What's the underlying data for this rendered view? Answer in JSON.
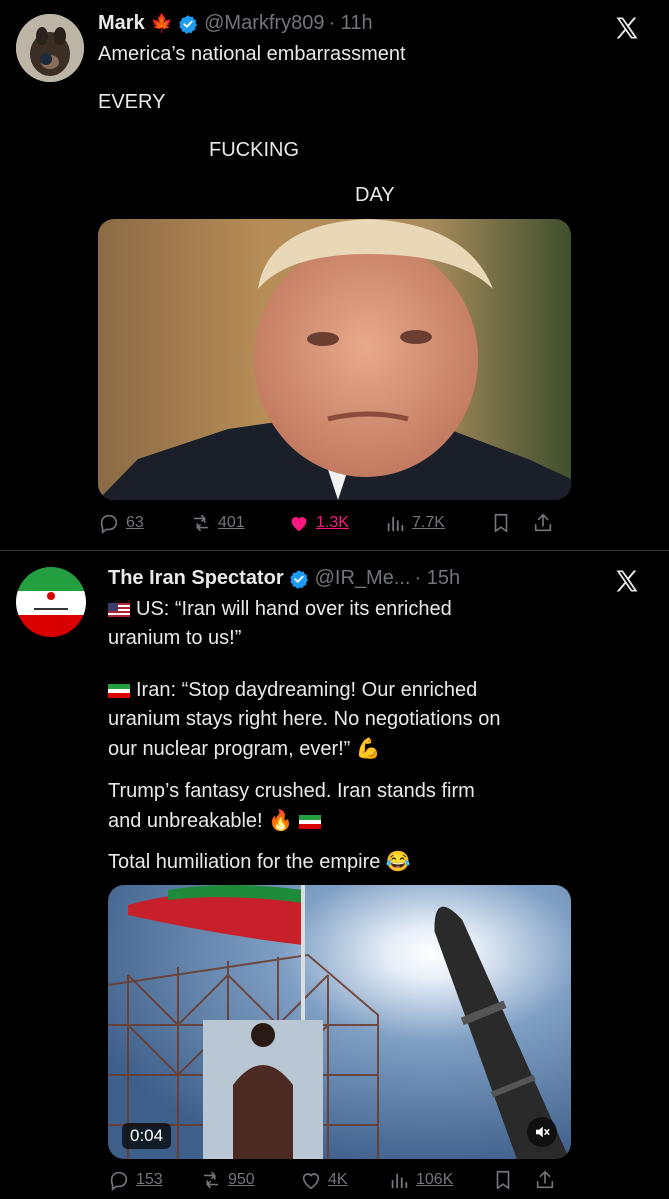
{
  "tweets": [
    {
      "name": "Mark",
      "name_emoji": "🍁",
      "handle": "@Markfry809",
      "time": "· 11h",
      "lines": [
        "America’s national embarrassment",
        "EVERY",
        "FUCKING",
        "DAY"
      ],
      "actions": {
        "replies": "63",
        "reposts": "401",
        "likes": "1.3K",
        "views": "7.7K"
      }
    },
    {
      "name": "The Iran Spectator",
      "handle": "@IR_Me...",
      "time": "· 15h",
      "avatar_caption": "The Iran Spectator",
      "lines": [
        "US: “Iran will hand over its enriched",
        "uranium to us!”",
        "Iran: “Stop daydreaming! Our enriched",
        "uranium stays right here. No negotiations on",
        "our nuclear program, ever!” 💪",
        "Trump’s fantasy crushed. Iran stands firm",
        "and unbreakable! 🔥",
        "Total humiliation for the empire 😂"
      ],
      "video_time": "0:04",
      "actions": {
        "replies": "153",
        "reposts": "950",
        "likes": "4K",
        "views": "106K"
      }
    }
  ],
  "colors": {
    "background": "#000000",
    "text": "#e7e9ea",
    "secondary": "#71767b",
    "like": "#f91880",
    "verified": "#1d9bf0"
  }
}
